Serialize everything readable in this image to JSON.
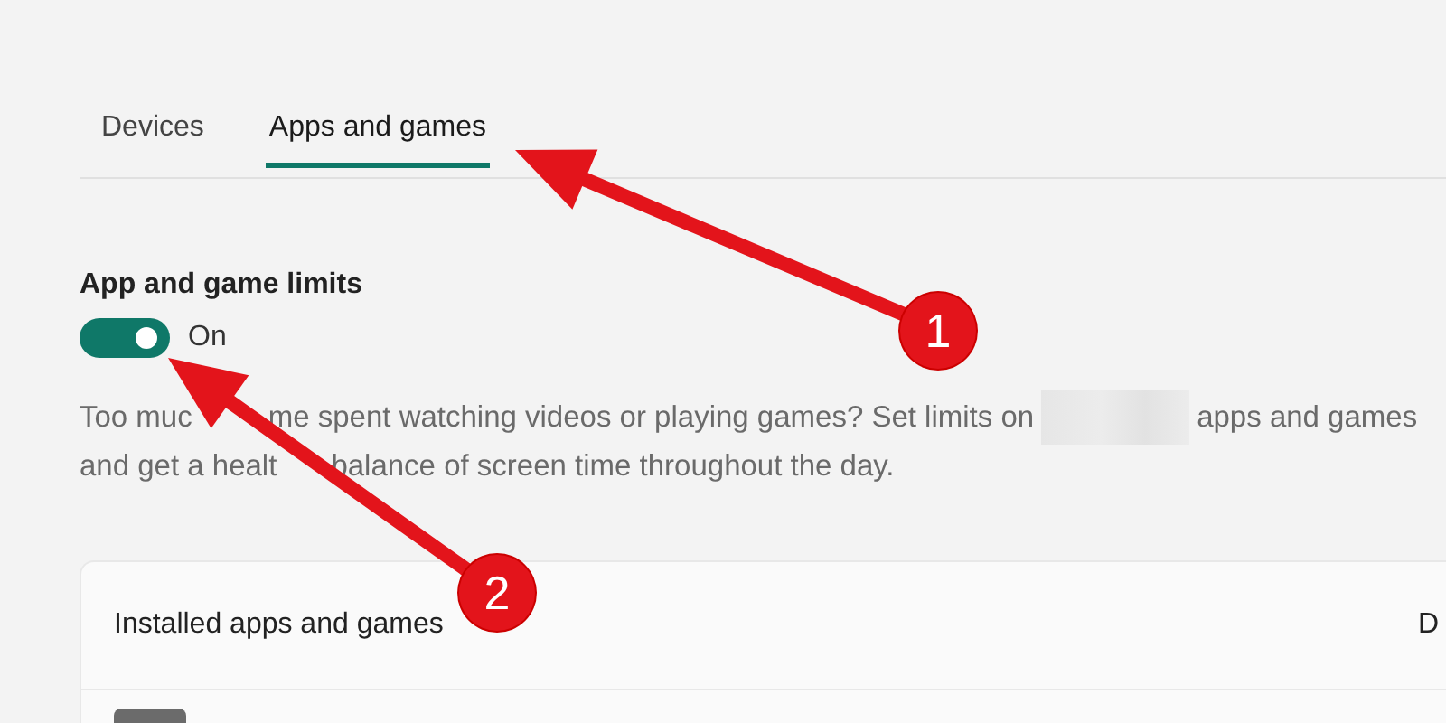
{
  "tabs": [
    {
      "label": "Devices",
      "selected": false
    },
    {
      "label": "Apps and games",
      "selected": true
    }
  ],
  "limits": {
    "heading": "App and game limits",
    "on": true,
    "state_label": "On",
    "description": {
      "line_1_a": "Too muc",
      "line_1_b": "me spent watching videos or playing games? Set limits on",
      "line_1_end": "apps and games",
      "line_2_a": "and get a healt",
      "line_2_b": "balance of screen time throughout the day."
    }
  },
  "card": {
    "title": "Installed apps and games",
    "column_2": "D"
  },
  "annotations": [
    {
      "number": "1"
    },
    {
      "number": "2"
    }
  ]
}
